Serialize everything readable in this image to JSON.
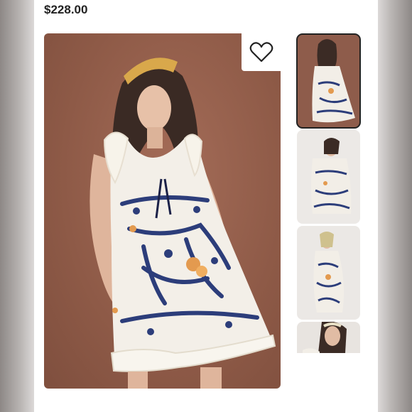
{
  "listing": {
    "price": "$228.00"
  },
  "main_image": {
    "subject": "product-photo-dress"
  },
  "favorite": {
    "icon": "heart-outline-icon"
  },
  "thumbnails": [
    {
      "selected": true
    },
    {
      "selected": false
    },
    {
      "selected": false
    },
    {
      "selected": false
    }
  ],
  "colors": {
    "backdrop": "#8e5a47",
    "dress": "#f3efe8",
    "print": "#2c3d7a",
    "accent": "#e39a4f"
  }
}
